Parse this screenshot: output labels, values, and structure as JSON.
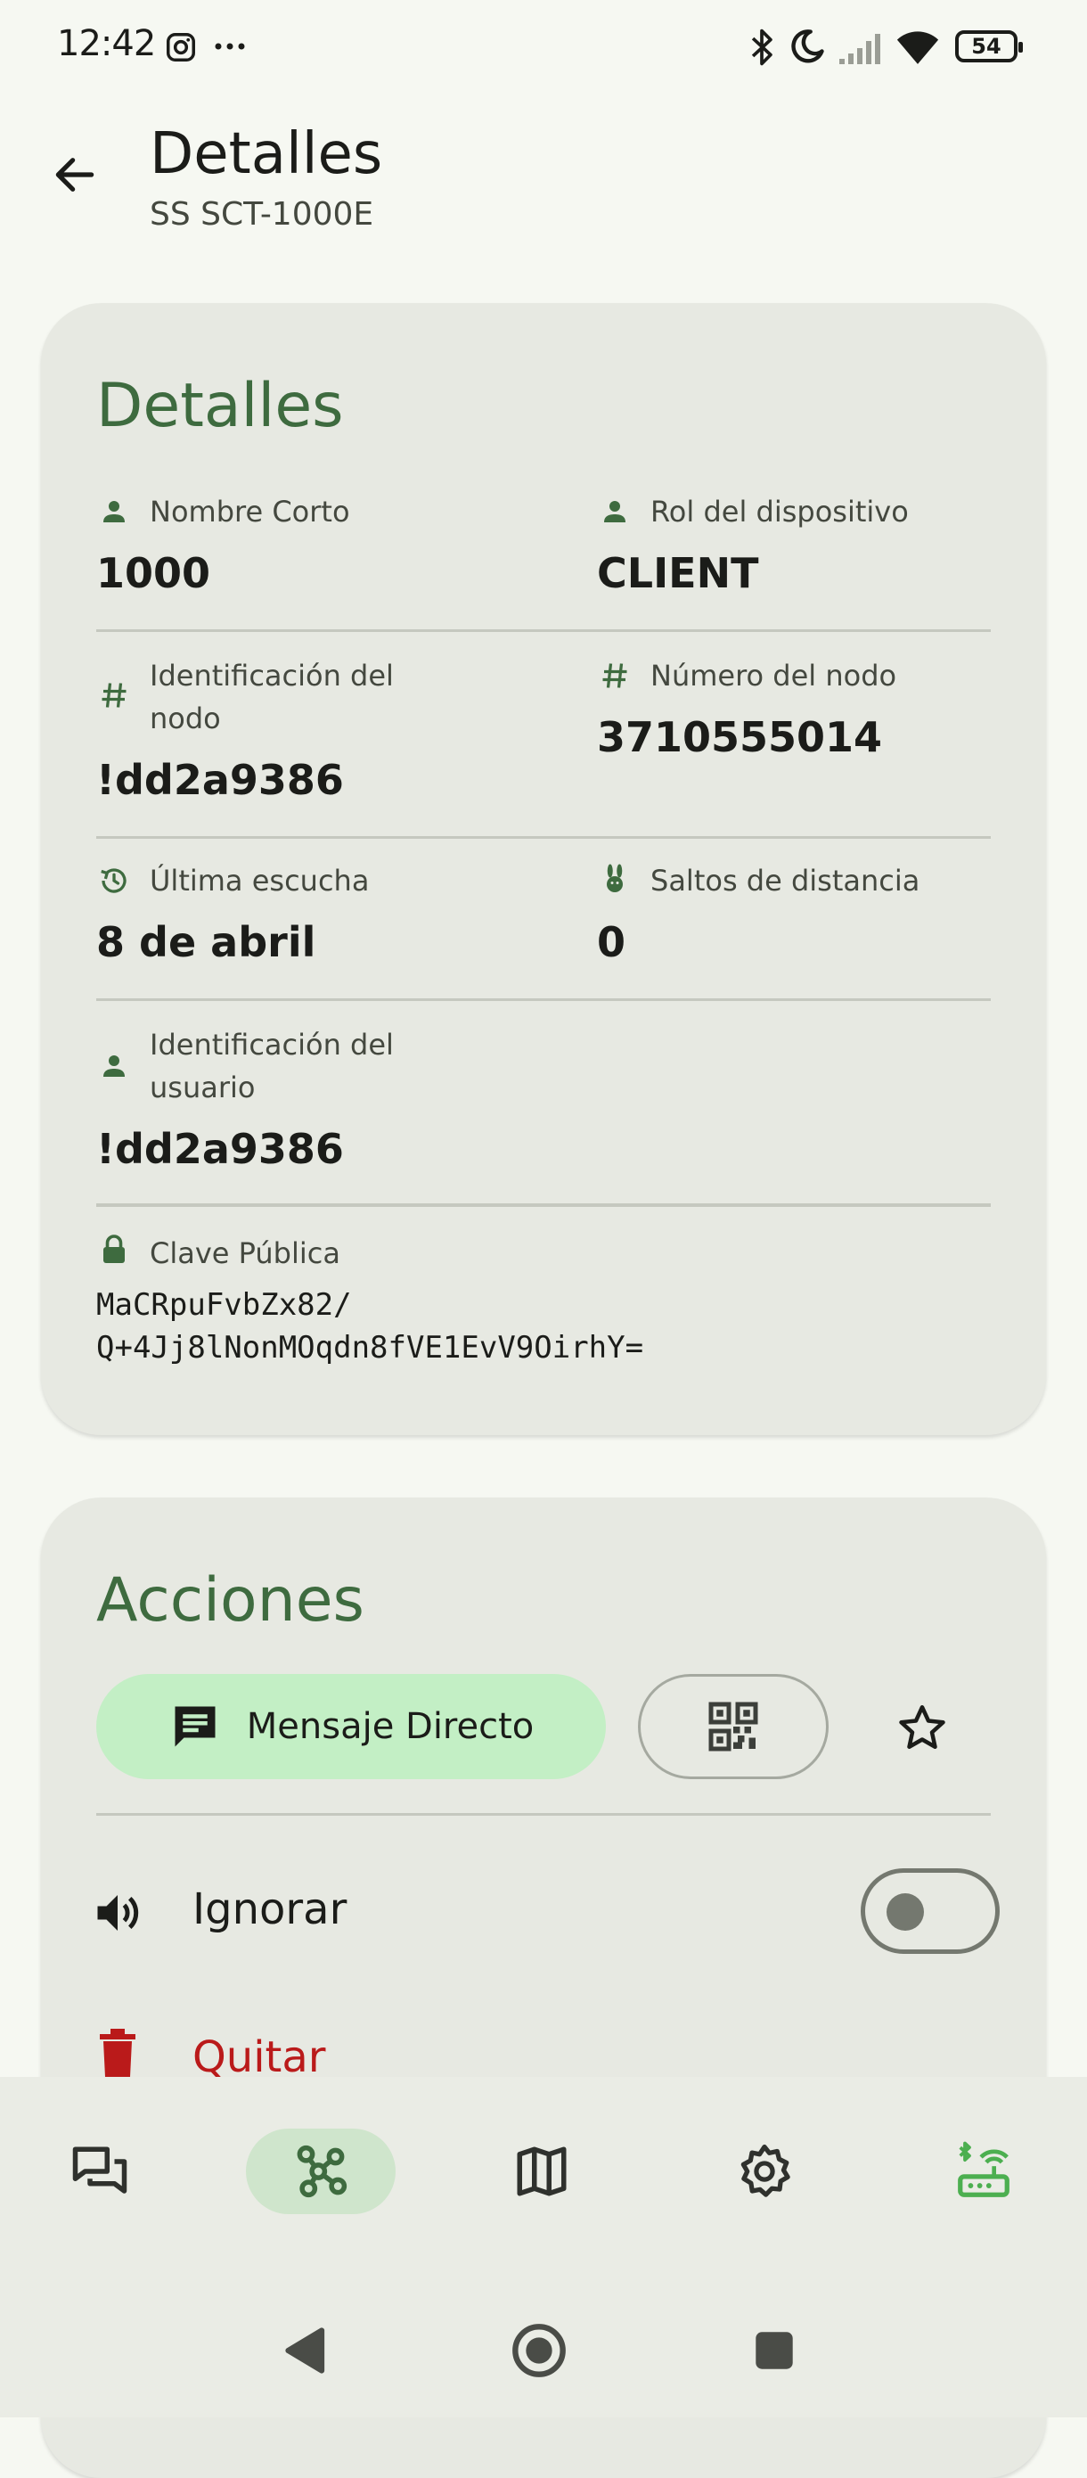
{
  "status_bar": {
    "time": "12:42",
    "battery": "54"
  },
  "app_bar": {
    "title": "Detalles",
    "subtitle": "SS SCT-1000E"
  },
  "details": {
    "title": "Detalles",
    "short_name_label": "Nombre Corto",
    "short_name_value": "1000",
    "role_label": "Rol del dispositivo",
    "role_value": "CLIENT",
    "node_id_label_line1": "Identificación del",
    "node_id_label_line2": "nodo",
    "node_id_value": "!dd2a9386",
    "node_num_label": "Número del nodo",
    "node_num_value": "3710555014",
    "last_heard_label": "Última escucha",
    "last_heard_value": "8 de abril",
    "hops_label": "Saltos de distancia",
    "hops_value": "0",
    "user_id_label_line1": "Identificación del",
    "user_id_label_line2": "usuario",
    "user_id_value": "!dd2a9386",
    "public_key_label": "Clave Pública",
    "public_key_line1": "MaCRpuFvbZx82/",
    "public_key_line2": "Q+4Jj8lNonMOqdn8fVE1EvV9OirhY="
  },
  "actions": {
    "title": "Acciones",
    "direct_message_label": "Mensaje Directo",
    "ignore_label": "Ignorar",
    "ignore_enabled": false,
    "remove_label": "Quitar"
  },
  "colors": {
    "accent": "#3e6b3f",
    "dm_button_bg": "#c3efc5",
    "danger": "#ba1a1a",
    "card_bg": "#e7e9e2",
    "nav_active_bg": "#cfe5cc",
    "connected_icon": "#4caf50"
  },
  "icons": {
    "status": [
      "instagram-icon",
      "more-dots-icon",
      "bluetooth-icon",
      "moon-icon",
      "signal-icon",
      "wifi-icon",
      "battery-icon"
    ],
    "bottom_nav": [
      "messages-icon",
      "nodes-icon",
      "map-icon",
      "settings-icon",
      "bluetooth-router-icon"
    ]
  }
}
